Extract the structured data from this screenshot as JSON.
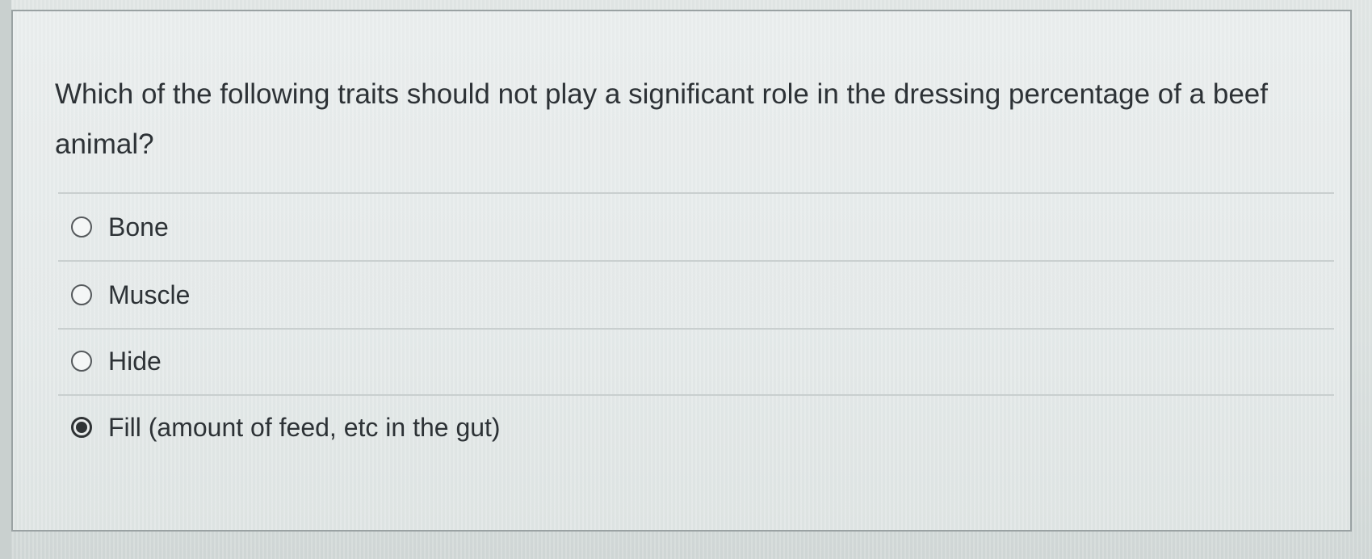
{
  "question": {
    "text": "Which of the following traits should not play a significant role in the dressing percentage of a beef animal?"
  },
  "options": [
    {
      "label": "Bone",
      "selected": false
    },
    {
      "label": "Muscle",
      "selected": false
    },
    {
      "label": "Hide",
      "selected": false
    },
    {
      "label": "Fill (amount of feed, etc in the gut)",
      "selected": true
    }
  ],
  "icons": {
    "radio_unselected": "radio-unchecked-icon",
    "radio_selected": "radio-checked-icon"
  },
  "colors": {
    "text": "#2d3236",
    "border": "#9aa2a3",
    "divider": "#c9cfcf",
    "radio_fill": "#2f3335"
  }
}
